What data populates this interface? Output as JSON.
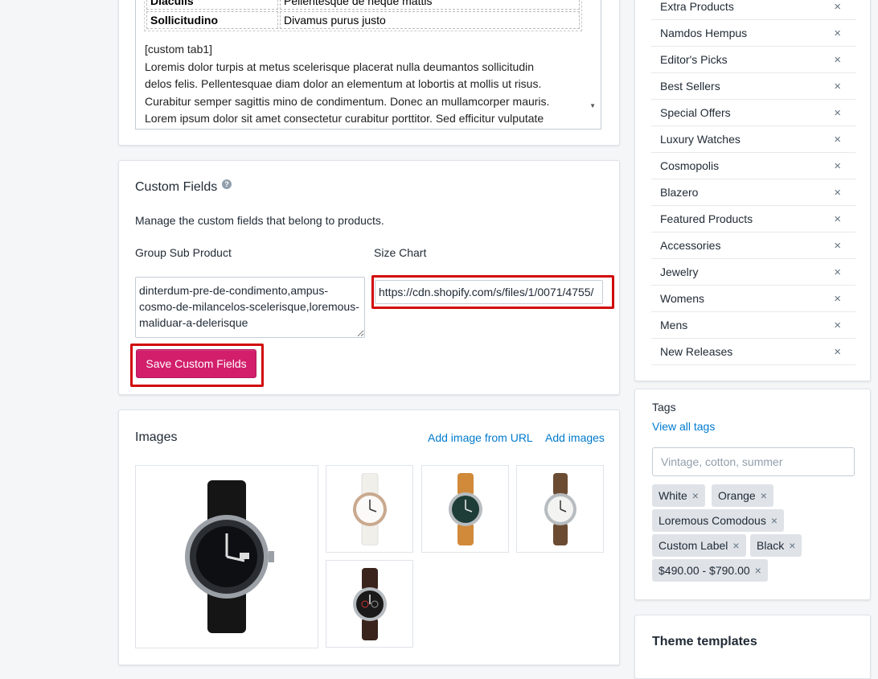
{
  "description": {
    "table": [
      {
        "key": "Diaculis",
        "value": "Pellentesque de neque mattis"
      },
      {
        "key": "Sollicitudino",
        "value": "Divamus purus justo"
      }
    ],
    "lines": [
      "[custom tab1]",
      "Loremis dolor turpis at metus scelerisque placerat nulla deumantos sollicitudin",
      "delos felis. Pellentesquae diam dolor an elementum at lobortis at mollis ut risus.",
      "Curabitur semper sagittis mino de condimentum. Donec an mullamcorper mauris.",
      "Lorem ipsum dolor sit amet consectetur curabitur porttitor. Sed efficitur vulputate"
    ]
  },
  "custom_fields": {
    "title": "Custom Fields",
    "help_icon": "question-circle-icon",
    "description": "Manage the custom fields that belong to products.",
    "group_sub_product_label": "Group Sub Product",
    "group_sub_product_value": "dinterdum-pre-de-condimento,ampus-cosmo-de-milancelos-scelerisque,loremous-maliduar-a-delerisque",
    "size_chart_label": "Size Chart",
    "size_chart_value": "https://cdn.shopify.com/s/files/1/0071/4755/",
    "save_label": "Save Custom Fields",
    "highlight_color": "#d10a0a",
    "button_color": "#d21e6b"
  },
  "images": {
    "title": "Images",
    "add_from_url": "Add image from URL",
    "add_images": "Add images"
  },
  "collections": [
    "Extra Products",
    "Namdos Hempus",
    "Editor's Picks",
    "Best Sellers",
    "Special Offers",
    "Luxury Watches",
    "Cosmopolis",
    "Blazero",
    "Featured Products",
    "Accessories",
    "Jewelry",
    "Womens",
    "Mens",
    "New Releases"
  ],
  "tags": {
    "label": "Tags",
    "view_all": "View all tags",
    "placeholder": "Vintage, cotton, summer",
    "items": [
      "White",
      "Orange",
      "Loremous Comodous",
      "Custom Label",
      "Black",
      "$490.00 - $790.00"
    ]
  },
  "theme_templates": {
    "title": "Theme templates"
  },
  "remove_glyph": "×"
}
